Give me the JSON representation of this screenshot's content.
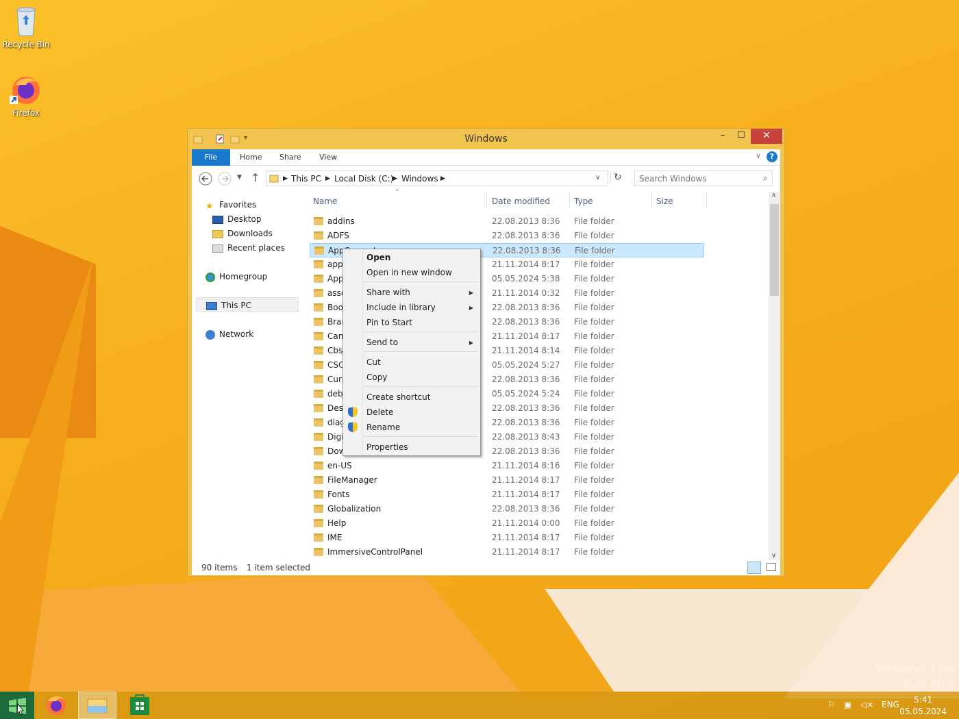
{
  "desktop": {
    "icons": [
      {
        "label": "Recycle Bin",
        "icon": "recycle-bin-icon"
      },
      {
        "label": "Firefox",
        "icon": "firefox-icon"
      }
    ],
    "watermark": [
      "Windows 8.1 Pro",
      "Build 9600"
    ]
  },
  "window": {
    "title": "Windows",
    "controls": {
      "minimize": "–",
      "maximize": "☐",
      "close": "✕"
    },
    "ribbon_tabs": [
      "File",
      "Home",
      "Share",
      "View"
    ],
    "address": {
      "crumbs": [
        "This PC",
        "Local Disk (C:)",
        "Windows"
      ],
      "search_placeholder": "Search Windows"
    },
    "nav_pane": {
      "favorites": "Favorites",
      "favorites_items": [
        "Desktop",
        "Downloads",
        "Recent places"
      ],
      "homegroup": "Homegroup",
      "this_pc": "This PC",
      "network": "Network"
    },
    "columns": [
      "Name",
      "Date modified",
      "Type",
      "Size"
    ],
    "files": [
      {
        "name": "addins",
        "date": "22.08.2013 8:36",
        "type": "File folder"
      },
      {
        "name": "ADFS",
        "date": "22.08.2013 8:36",
        "type": "File folder"
      },
      {
        "name": "AppCompat",
        "date": "22.08.2013 8:36",
        "type": "File folder",
        "selected": true
      },
      {
        "name": "apppatch",
        "date": "21.11.2014 8:17",
        "type": "File folder"
      },
      {
        "name": "AppReadiness",
        "date": "05.05.2024 5:38",
        "type": "File folder"
      },
      {
        "name": "assembly",
        "date": "21.11.2014 0:32",
        "type": "File folder"
      },
      {
        "name": "Boot",
        "date": "22.08.2013 8:36",
        "type": "File folder"
      },
      {
        "name": "Branding",
        "date": "22.08.2013 8:36",
        "type": "File folder"
      },
      {
        "name": "Camera",
        "date": "21.11.2014 8:17",
        "type": "File folder"
      },
      {
        "name": "CbsTemp",
        "date": "21.11.2014 8:14",
        "type": "File folder"
      },
      {
        "name": "CSC",
        "date": "05.05.2024 5:27",
        "type": "File folder"
      },
      {
        "name": "Cursors",
        "date": "22.08.2013 8:36",
        "type": "File folder"
      },
      {
        "name": "debug",
        "date": "05.05.2024 5:24",
        "type": "File folder"
      },
      {
        "name": "Desktop",
        "date": "22.08.2013 8:36",
        "type": "File folder"
      },
      {
        "name": "diagnostics",
        "date": "22.08.2013 8:36",
        "type": "File folder"
      },
      {
        "name": "DigitalLocker",
        "date": "22.08.2013 8:43",
        "type": "File folder"
      },
      {
        "name": "Downloaded Program Files",
        "date": "22.08.2013 8:36",
        "type": "File folder"
      },
      {
        "name": "en-US",
        "date": "21.11.2014 8:16",
        "type": "File folder"
      },
      {
        "name": "FileManager",
        "date": "21.11.2014 8:17",
        "type": "File folder"
      },
      {
        "name": "Fonts",
        "date": "21.11.2014 8:17",
        "type": "File folder"
      },
      {
        "name": "Globalization",
        "date": "22.08.2013 8:36",
        "type": "File folder"
      },
      {
        "name": "Help",
        "date": "21.11.2014 0:00",
        "type": "File folder"
      },
      {
        "name": "IME",
        "date": "21.11.2014 8:17",
        "type": "File folder"
      },
      {
        "name": "ImmersiveControlPanel",
        "date": "21.11.2014 8:17",
        "type": "File folder"
      }
    ],
    "status": {
      "items": "90 items",
      "selected": "1 item selected"
    }
  },
  "context_menu": {
    "open": "Open",
    "open_new_window": "Open in new window",
    "share_with": "Share with",
    "include_in_library": "Include in library",
    "pin_to_start": "Pin to Start",
    "send_to": "Send to",
    "cut": "Cut",
    "copy": "Copy",
    "create_shortcut": "Create shortcut",
    "delete": "Delete",
    "rename": "Rename",
    "properties": "Properties"
  },
  "taskbar": {
    "language": "ENG",
    "time": "5:41",
    "date": "05.05.2024"
  }
}
